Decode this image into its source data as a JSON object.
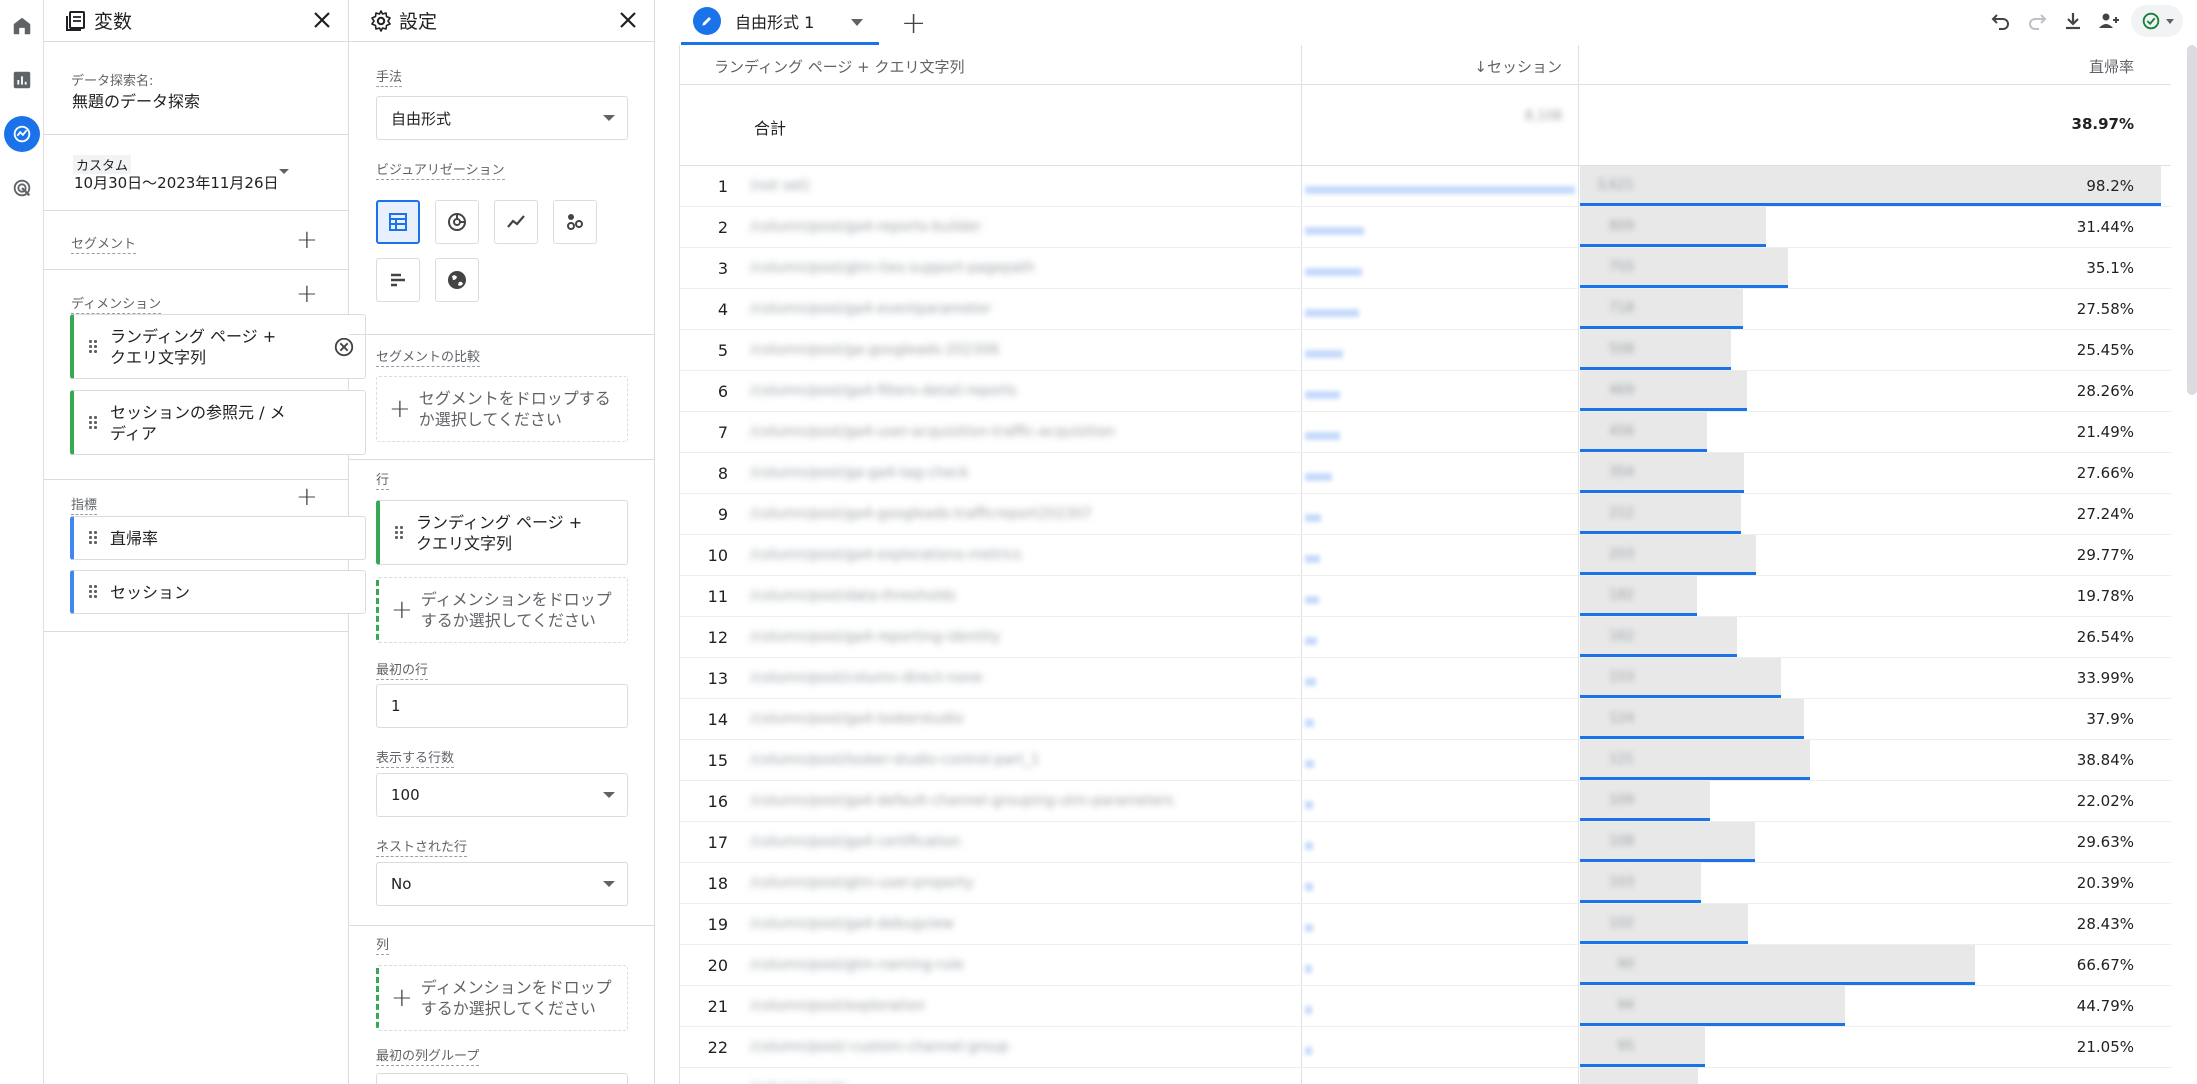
{
  "rail": {
    "items": [
      {
        "icon": "home-icon"
      },
      {
        "icon": "reports-icon"
      },
      {
        "icon": "explore-icon",
        "active": true
      },
      {
        "icon": "advertising-icon"
      }
    ]
  },
  "variables": {
    "title": "変数",
    "exploration_name_label": "データ探索名:",
    "exploration_name": "無題のデータ探索",
    "date_type": "カスタム",
    "date_range": "10月30日～2023年11月26日",
    "segments_label": "セグメント",
    "dimensions_label": "ディメンション",
    "dimensions": [
      "ランディング ページ + クエリ文字列",
      "セッションの参照元 / メディア"
    ],
    "metrics_label": "指標",
    "metrics": [
      "直帰率",
      "セッション"
    ]
  },
  "settings": {
    "title": "設定",
    "technique_label": "手法",
    "technique_value": "自由形式",
    "visualization_label": "ビジュアリゼーション",
    "segment_compare_label": "セグメントの比較",
    "segment_drop_text": "セグメントをドロップするか選択してください",
    "rows_label": "行",
    "rows_item": "ランディング ページ + クエリ文字列",
    "rows_drop_text": "ディメンションをドロップするか選択してください",
    "first_row_label": "最初の行",
    "first_row_value": "1",
    "show_rows_label": "表示する行数",
    "show_rows_value": "100",
    "nested_rows_label": "ネストされた行",
    "nested_rows_value": "No",
    "columns_label": "列",
    "columns_drop_text": "ディメンションをドロップするか選択してください",
    "first_col_group_label": "最初の列グループ"
  },
  "tab": {
    "label": "自由形式 1"
  },
  "toolbar": {
    "icons": [
      "undo-icon",
      "redo-icon",
      "download-icon",
      "share-icon",
      "check-status-icon"
    ]
  },
  "table": {
    "headers": {
      "dimension": "ランディング ページ + クエリ文字列",
      "sessions": "↓セッション",
      "bounce": "直帰率"
    },
    "totals": {
      "label": "合計",
      "sessions": "8,108",
      "bounce": "38.97%"
    },
    "rows": [
      {
        "n": "1",
        "page": "(not set)",
        "sessions": "3,621",
        "bounce": "98.2%",
        "bounce_rate": 98.2,
        "session_share": 1.0
      },
      {
        "n": "2",
        "page": "/column/post/ga4-reports-builder",
        "sessions": "809",
        "bounce": "31.44%",
        "bounce_rate": 31.44,
        "session_share": 0.22
      },
      {
        "n": "3",
        "page": "/column/post/gtm-ties-support-pagepath",
        "sessions": "755",
        "bounce": "35.1%",
        "bounce_rate": 35.1,
        "session_share": 0.21
      },
      {
        "n": "4",
        "page": "/column/post/ga4-eventparameter",
        "sessions": "718",
        "bounce": "27.58%",
        "bounce_rate": 27.58,
        "session_share": 0.2
      },
      {
        "n": "5",
        "page": "/column/post/ga-googleads-202306",
        "sessions": "508",
        "bounce": "25.45%",
        "bounce_rate": 25.45,
        "session_share": 0.14
      },
      {
        "n": "6",
        "page": "/column/post/ga4-filters-detail-reports",
        "sessions": "469",
        "bounce": "28.26%",
        "bounce_rate": 28.26,
        "session_share": 0.13
      },
      {
        "n": "7",
        "page": "/column/post/ga4-user-acquisition-traffic-acquisition",
        "sessions": "456",
        "bounce": "21.49%",
        "bounce_rate": 21.49,
        "session_share": 0.13
      },
      {
        "n": "8",
        "page": "/column/post/ga-ga4-tag-check",
        "sessions": "354",
        "bounce": "27.66%",
        "bounce_rate": 27.66,
        "session_share": 0.1
      },
      {
        "n": "9",
        "page": "/column/post/ga4-googleads-trafficreport202307",
        "sessions": "212",
        "bounce": "27.24%",
        "bounce_rate": 27.24,
        "session_share": 0.06
      },
      {
        "n": "10",
        "page": "/column/post/ga4-explorations-metrics",
        "sessions": "203",
        "bounce": "29.77%",
        "bounce_rate": 29.77,
        "session_share": 0.056
      },
      {
        "n": "11",
        "page": "/column/post/data-thresholds",
        "sessions": "182",
        "bounce": "19.78%",
        "bounce_rate": 19.78,
        "session_share": 0.05
      },
      {
        "n": "12",
        "page": "/column/post/ga4-reporting-identity",
        "sessions": "162",
        "bounce": "26.54%",
        "bounce_rate": 26.54,
        "session_share": 0.045
      },
      {
        "n": "13",
        "page": "/column/post/column-direct-none",
        "sessions": "153",
        "bounce": "33.99%",
        "bounce_rate": 33.99,
        "session_share": 0.042
      },
      {
        "n": "14",
        "page": "/column/post/ga4-lookerstudio",
        "sessions": "124",
        "bounce": "37.9%",
        "bounce_rate": 37.9,
        "session_share": 0.034
      },
      {
        "n": "15",
        "page": "/column/post/looker-studio-control-part_1",
        "sessions": "121",
        "bounce": "38.84%",
        "bounce_rate": 38.84,
        "session_share": 0.033
      },
      {
        "n": "16",
        "page": "/column/post/ga4-default-channel-grouping-utm-parameters",
        "sessions": "109",
        "bounce": "22.02%",
        "bounce_rate": 22.02,
        "session_share": 0.03
      },
      {
        "n": "17",
        "page": "/column/post/ga4-certification",
        "sessions": "108",
        "bounce": "29.63%",
        "bounce_rate": 29.63,
        "session_share": 0.03
      },
      {
        "n": "18",
        "page": "/column/post/gtm-user-property",
        "sessions": "103",
        "bounce": "20.39%",
        "bounce_rate": 20.39,
        "session_share": 0.028
      },
      {
        "n": "19",
        "page": "/column/post/ga4-debugview",
        "sessions": "102",
        "bounce": "28.43%",
        "bounce_rate": 28.43,
        "session_share": 0.028
      },
      {
        "n": "20",
        "page": "/column/post/gtm-naming-rule",
        "sessions": "90",
        "bounce": "66.67%",
        "bounce_rate": 66.67,
        "session_share": 0.025
      },
      {
        "n": "21",
        "page": "/column/post/exploration",
        "sessions": "94",
        "bounce": "44.79%",
        "bounce_rate": 44.79,
        "session_share": 0.026
      },
      {
        "n": "22",
        "page": "/column/post/-custom-channel-group",
        "sessions": "95",
        "bounce": "21.05%",
        "bounce_rate": 21.05,
        "session_share": 0.026
      },
      {
        "n": "",
        "page": "/column/post/",
        "sessions": "",
        "bounce": "",
        "bounce_rate": 20.0,
        "session_share": 0.02
      }
    ]
  },
  "colors": {
    "accent": "#1a73e8",
    "dimension_chip": "#34a853",
    "metric_chip": "#4285f4",
    "bar_bg": "#e8e8e8"
  }
}
